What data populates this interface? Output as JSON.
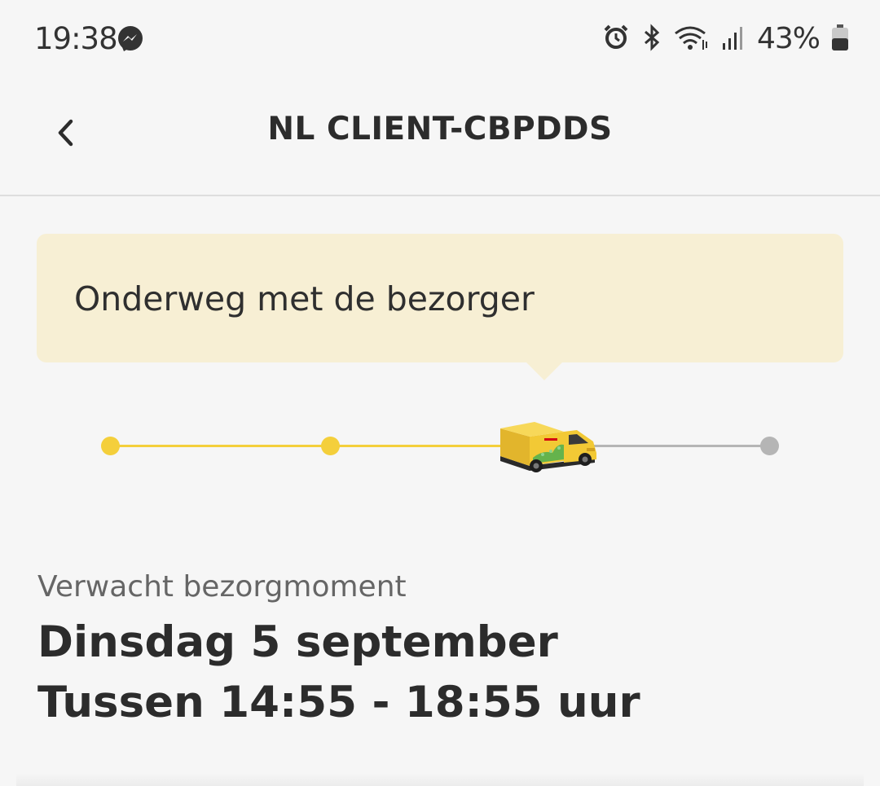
{
  "status_bar": {
    "time": "19:38",
    "battery": "43%",
    "icons": [
      "messenger-icon",
      "alarm-icon",
      "bluetooth-icon",
      "wifi-icon",
      "signal-icon",
      "battery-icon"
    ]
  },
  "header": {
    "title": "NL CLIENT-CBPDDS",
    "back_icon": "chevron-left-icon"
  },
  "status_card": {
    "text": "Onderweg met de bezorger"
  },
  "progress": {
    "steps_total": 4,
    "current_step": 3,
    "active_color": "#f4cf3b",
    "inactive_color": "#b5b5b5"
  },
  "delivery": {
    "label": "Verwacht bezorgmoment",
    "date": "Dinsdag 5 september",
    "time_window": "Tussen 14:55 - 18:55 uur"
  }
}
